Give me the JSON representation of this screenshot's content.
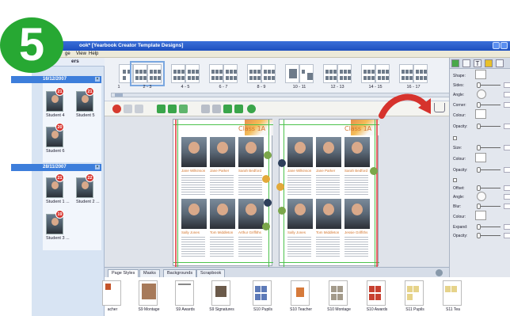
{
  "window": {
    "title": "ook* [Yearbook Creator Template Designs]"
  },
  "menu": [
    "ge",
    "View",
    "Help"
  ],
  "step_badge": "5",
  "left_panel": {
    "header": "ers",
    "groups": [
      {
        "date": "16/12/2007",
        "students": [
          {
            "name": "Student 4",
            "count": "21"
          },
          {
            "name": "Student 5",
            "count": "21"
          },
          {
            "name": "Student 6",
            "count": "20"
          }
        ]
      },
      {
        "date": "28/11/2007",
        "students": [
          {
            "name": "Student 1 ...",
            "count": "21"
          },
          {
            "name": "Student 2 ...",
            "count": "22"
          },
          {
            "name": "Student 3 ...",
            "count": "19"
          }
        ]
      }
    ]
  },
  "filmstrip": {
    "spreads": [
      "1",
      "2 - 3",
      "4 - 5",
      "6 - 7",
      "8 - 9",
      "10 - 11",
      "12 - 13",
      "14 - 15",
      "16 - 17"
    ]
  },
  "canvas": {
    "left_page": {
      "title": "Class 1A",
      "names": [
        "Jane Wilkinson",
        "Jane Parker",
        "Sarah Bedford",
        "Sally Jones",
        "Tom Middleton",
        "Arthur Griffiths"
      ]
    },
    "right_page": {
      "title": "Class 1A",
      "names": [
        "Jane Wilkinson",
        "Jane Parker",
        "Sarah Bedford",
        "Sally Jones",
        "Tom Middleton",
        "Jessie Griffiths"
      ]
    }
  },
  "properties": {
    "tabs": [
      "style-icon",
      "layout-icon",
      "T",
      "color-icon",
      "page-icon"
    ],
    "shape": "Shape:",
    "sides": "Sides:",
    "angle": "Angle:",
    "corner": "Corner:",
    "colour": "Colour:",
    "opacity": "Opacity:",
    "size": "Size:",
    "colour2": "Colour:",
    "opacity2": "Opacity:",
    "offset": "Offset:",
    "angle2": "Angle:",
    "blur": "Blur:",
    "colour3": "Colour:",
    "expand": "Expand:",
    "opacity3": "Opacity:"
  },
  "bottom_tabs": [
    "Page Styles",
    "Masks",
    "Backgrounds",
    "Scrapbook"
  ],
  "page_styles": [
    "acher",
    "S9 Montage",
    "S9 Awards",
    "S9 Signatures",
    "S10 Pupils",
    "S10 Teacher",
    "S10 Montage",
    "S10 Awards",
    "S11 Pupils",
    "S11 Tea"
  ],
  "colors": {
    "title_bar": "#1d4fbf",
    "step_badge": "#27a833",
    "date_header": "#3d7edb",
    "count_badge": "#d6332d",
    "class_title": "#d4762e",
    "arrow": "#d6332d"
  }
}
